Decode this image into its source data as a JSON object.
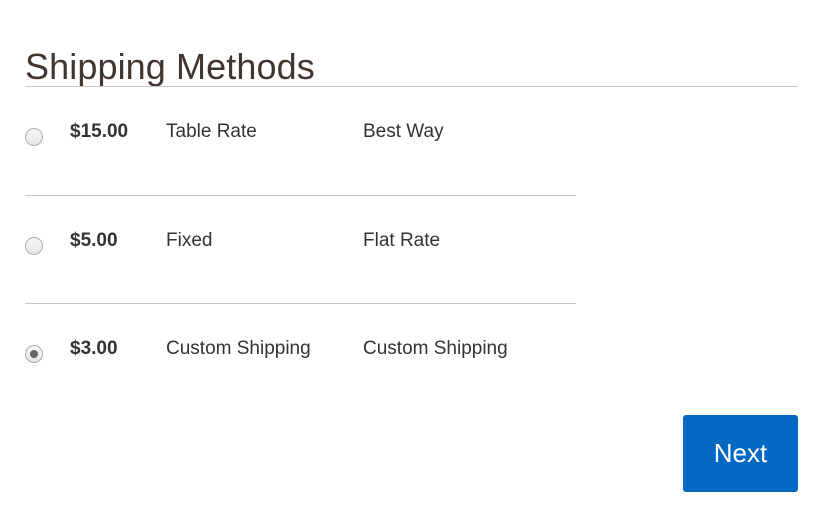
{
  "page": {
    "title": "Shipping Methods"
  },
  "shipping_methods": {
    "rows": [
      {
        "price": "$15.00",
        "method": "Table Rate",
        "carrier": "Best Way",
        "selected": false
      },
      {
        "price": "$5.00",
        "method": "Fixed",
        "carrier": "Flat Rate",
        "selected": false
      },
      {
        "price": "$3.00",
        "method": "Custom Shipping",
        "carrier": "Custom Shipping",
        "selected": true
      }
    ]
  },
  "actions": {
    "next_label": "Next"
  },
  "colors": {
    "accent_blue": "#0568c2",
    "title_text": "#41362f",
    "body_text": "#333333",
    "divider": "#c6c6c6",
    "radio_border": "#adadad",
    "radio_dot": "#666666"
  }
}
